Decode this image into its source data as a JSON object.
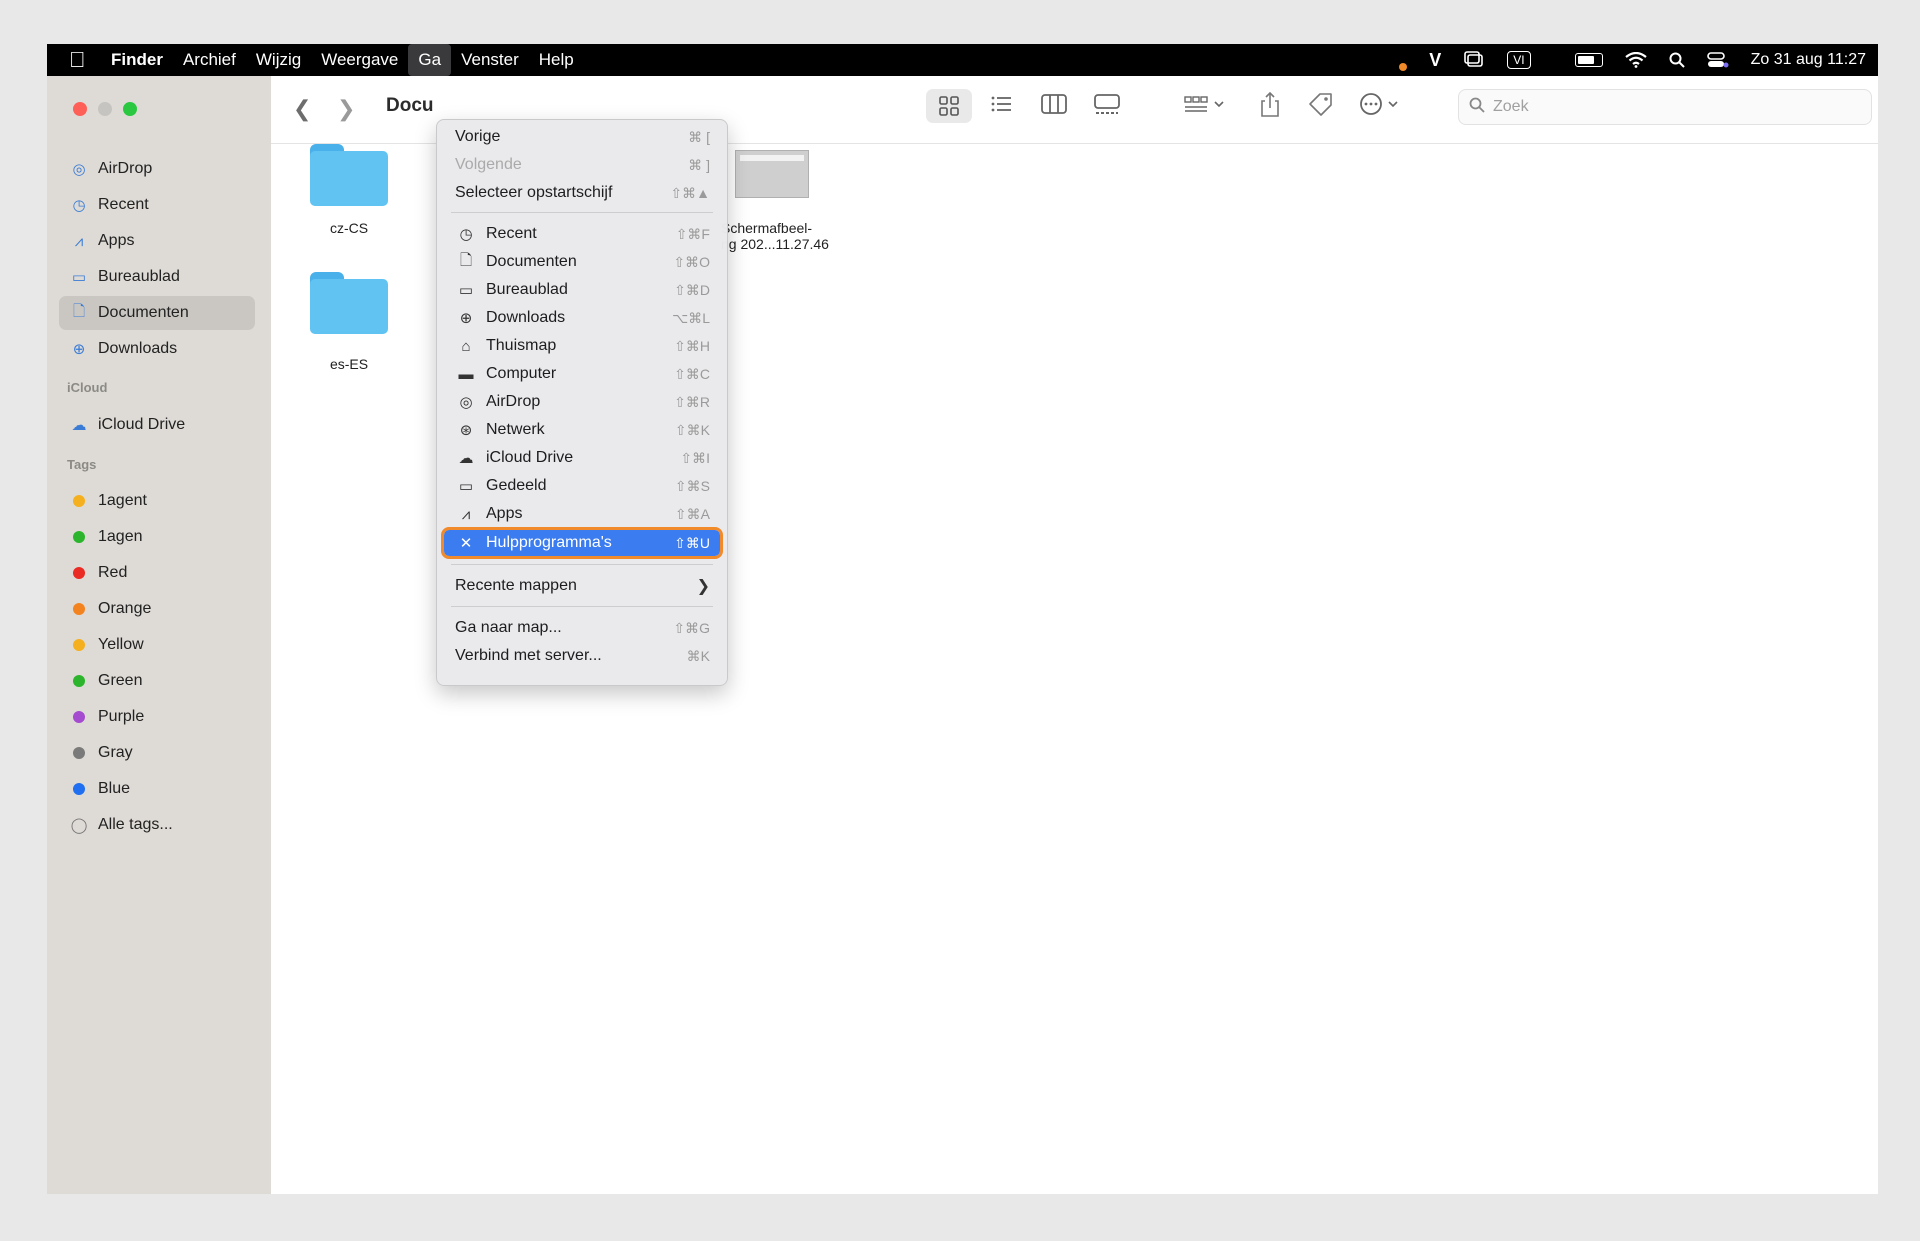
{
  "menubar": {
    "app": "Finder",
    "menus": [
      "Archief",
      "Wijzig",
      "Weergave",
      "Ga",
      "Venster",
      "Help"
    ],
    "clock": "Zo 31 aug  11:27",
    "vi_label": "VI",
    "v_label": "V"
  },
  "sidebar": {
    "favorites": [
      {
        "label": "AirDrop",
        "icon": "airdrop-icon",
        "glyph": "◎"
      },
      {
        "label": "Recent",
        "icon": "clock-icon",
        "glyph": "◷"
      },
      {
        "label": "Apps",
        "icon": "apps-icon",
        "glyph": "⩘"
      },
      {
        "label": "Bureaublad",
        "icon": "desktop-icon",
        "glyph": "▭"
      },
      {
        "label": "Documenten",
        "icon": "document-icon",
        "glyph": "🗋"
      },
      {
        "label": "Downloads",
        "icon": "download-icon",
        "glyph": "⊕"
      }
    ],
    "icloud_header": "iCloud",
    "icloud": [
      {
        "label": "iCloud Drive",
        "icon": "cloud-icon",
        "glyph": "☁"
      }
    ],
    "tags_header": "Tags",
    "tags": [
      {
        "label": "1agent",
        "color": "#f5b01f"
      },
      {
        "label": "1agen",
        "color": "#2cb52c"
      },
      {
        "label": "Red",
        "color": "#ea2b23"
      },
      {
        "label": "Orange",
        "color": "#f3831f"
      },
      {
        "label": "Yellow",
        "color": "#f5b01f"
      },
      {
        "label": "Green",
        "color": "#2cb52c"
      },
      {
        "label": "Purple",
        "color": "#a54bd0"
      },
      {
        "label": "Gray",
        "color": "#7a7a7a"
      },
      {
        "label": "Blue",
        "color": "#1f6ff0"
      }
    ],
    "all_tags": "Alle tags..."
  },
  "toolbar": {
    "title": "Docu",
    "search_placeholder": "Zoek"
  },
  "files": [
    {
      "name": "cz-CS",
      "type": "folder"
    },
    {
      "name": "es-ES",
      "type": "folder"
    },
    {
      "name_line1": "Schermafbeel-",
      "name_line2": "ng 202...11.27.46",
      "type": "image"
    }
  ],
  "go_menu": {
    "items_top": [
      {
        "label": "Vorige",
        "shortcut": "⌘ [",
        "disabled": false
      },
      {
        "label": "Volgende",
        "shortcut": "⌘ ]",
        "disabled": true
      },
      {
        "label": "Selecteer opstartschijf",
        "shortcut": "⇧⌘▲",
        "disabled": false
      }
    ],
    "items_places": [
      {
        "label": "Recent",
        "shortcut": "⇧⌘F",
        "icon": "clock-icon",
        "glyph": "◷"
      },
      {
        "label": "Documenten",
        "shortcut": "⇧⌘O",
        "icon": "document-icon",
        "glyph": "🗋"
      },
      {
        "label": "Bureaublad",
        "shortcut": "⇧⌘D",
        "icon": "desktop-icon",
        "glyph": "▭"
      },
      {
        "label": "Downloads",
        "shortcut": "⌥⌘L",
        "icon": "download-icon",
        "glyph": "⊕"
      },
      {
        "label": "Thuismap",
        "shortcut": "⇧⌘H",
        "icon": "home-icon",
        "glyph": "⌂"
      },
      {
        "label": "Computer",
        "shortcut": "⇧⌘C",
        "icon": "laptop-icon",
        "glyph": "▬"
      },
      {
        "label": "AirDrop",
        "shortcut": "⇧⌘R",
        "icon": "airdrop-icon",
        "glyph": "◎"
      },
      {
        "label": "Netwerk",
        "shortcut": "⇧⌘K",
        "icon": "globe-icon",
        "glyph": "⊛"
      },
      {
        "label": "iCloud Drive",
        "shortcut": "⇧⌘I",
        "icon": "cloud-icon",
        "glyph": "☁"
      },
      {
        "label": "Gedeeld",
        "shortcut": "⇧⌘S",
        "icon": "shared-folder-icon",
        "glyph": "▭"
      },
      {
        "label": "Apps",
        "shortcut": "⇧⌘A",
        "icon": "apps-icon",
        "glyph": "⩘"
      },
      {
        "label": "Hulpprogramma's",
        "shortcut": "⇧⌘U",
        "icon": "tools-icon",
        "glyph": "✕",
        "highlighted": true
      }
    ],
    "recent_folders": "Recente mappen",
    "items_bottom": [
      {
        "label": "Ga naar map...",
        "shortcut": "⇧⌘G"
      },
      {
        "label": "Verbind met server...",
        "shortcut": "⌘K"
      }
    ]
  }
}
